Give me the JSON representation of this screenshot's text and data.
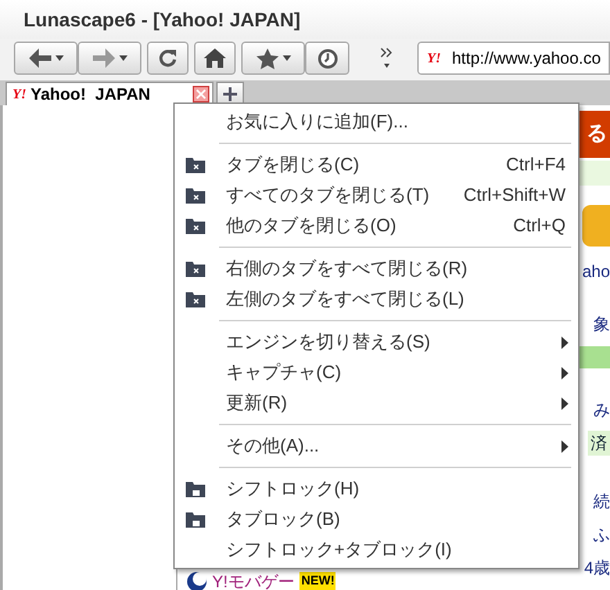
{
  "window": {
    "title": "Lunascape6 - [Yahoo! JAPAN]"
  },
  "address": {
    "logo": "Y!",
    "value": "http://www.yahoo.co"
  },
  "tab": {
    "title": "Yahoo!  JAPAN",
    "logo": "Y!"
  },
  "page_fragments": [
    {
      "text": "る",
      "kind": "header"
    },
    {
      "text": "aho",
      "kind": "link"
    },
    {
      "text": "象",
      "kind": "link"
    },
    {
      "text": "み",
      "kind": "link"
    },
    {
      "text": "済",
      "kind": "tab"
    },
    {
      "text": "続",
      "kind": "link"
    },
    {
      "text": "ふ",
      "kind": "link"
    },
    {
      "text": "4歳",
      "kind": "link"
    }
  ],
  "page_bottom": {
    "label": "Y!モバゲー",
    "badge": "NEW!"
  },
  "menu": [
    {
      "kind": "plain",
      "label": "お気に入りに追加(F)...",
      "submenu": false
    },
    {
      "kind": "separator"
    },
    {
      "kind": "close",
      "label": "タブを閉じる(C)",
      "shortcut": "Ctrl+F4",
      "submenu": false
    },
    {
      "kind": "close",
      "label": "すべてのタブを閉じる(T)",
      "shortcut": "Ctrl+Shift+W",
      "submenu": false
    },
    {
      "kind": "close",
      "label": "他のタブを閉じる(O)",
      "shortcut": "Ctrl+Q",
      "submenu": false
    },
    {
      "kind": "separator"
    },
    {
      "kind": "close",
      "label": "右側のタブをすべて閉じる(R)",
      "submenu": false
    },
    {
      "kind": "close",
      "label": "左側のタブをすべて閉じる(L)",
      "submenu": false
    },
    {
      "kind": "separator"
    },
    {
      "kind": "plain",
      "label": "エンジンを切り替える(S)",
      "submenu": true
    },
    {
      "kind": "plain",
      "label": "キャプチャ(C)",
      "submenu": true
    },
    {
      "kind": "plain",
      "label": "更新(R)",
      "submenu": true
    },
    {
      "kind": "separator"
    },
    {
      "kind": "plain",
      "label": "その他(A)...",
      "submenu": true
    },
    {
      "kind": "separator"
    },
    {
      "kind": "lock",
      "label": "シフトロック(H)",
      "submenu": false
    },
    {
      "kind": "lock",
      "label": "タブロック(B)",
      "submenu": false
    },
    {
      "kind": "plain",
      "label": "シフトロック+タブロック(I)",
      "submenu": false
    }
  ]
}
